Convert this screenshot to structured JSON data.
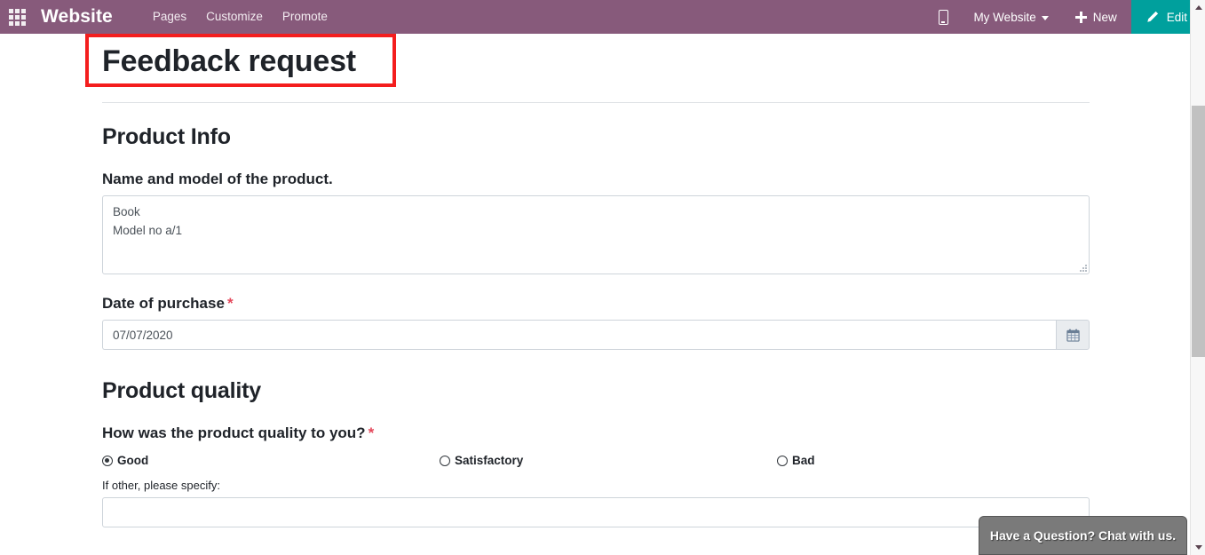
{
  "navbar": {
    "apps_icon": "apps-grid-icon",
    "brand": "Website",
    "menu": [
      {
        "label": "Pages"
      },
      {
        "label": "Customize"
      },
      {
        "label": "Promote"
      }
    ],
    "mobile_preview_icon": "mobile-phone-icon",
    "site_switcher": "My Website",
    "new_label": "New",
    "new_icon": "plus-icon",
    "edit_label": "Edit",
    "edit_icon": "pencil-icon",
    "bg_color": "#875A7B",
    "edit_bg_color": "#00A09D"
  },
  "page": {
    "title": "Feedback request",
    "highlight_color": "#f41e1e"
  },
  "sections": {
    "product_info": {
      "heading": "Product Info",
      "name_model": {
        "label": "Name and model of the product.",
        "value": "Book\nModel no a/1"
      },
      "date_of_purchase": {
        "label": "Date of purchase",
        "required_marker": "*",
        "value": "07/07/2020",
        "calendar_icon": "calendar-icon"
      }
    },
    "product_quality": {
      "heading": "Product quality",
      "question": {
        "label": "How was the product quality to you?",
        "required_marker": "*",
        "options": [
          {
            "label": "Good",
            "selected": true
          },
          {
            "label": "Satisfactory",
            "selected": false
          },
          {
            "label": "Bad",
            "selected": false
          }
        ]
      },
      "other_specify": {
        "label": "If other, please specify:",
        "value": ""
      }
    }
  },
  "chat_widget": {
    "label": "Have a Question? Chat with us."
  },
  "scrollbar": {
    "up_icon": "chevron-up-icon",
    "down_icon": "chevron-down-icon"
  }
}
